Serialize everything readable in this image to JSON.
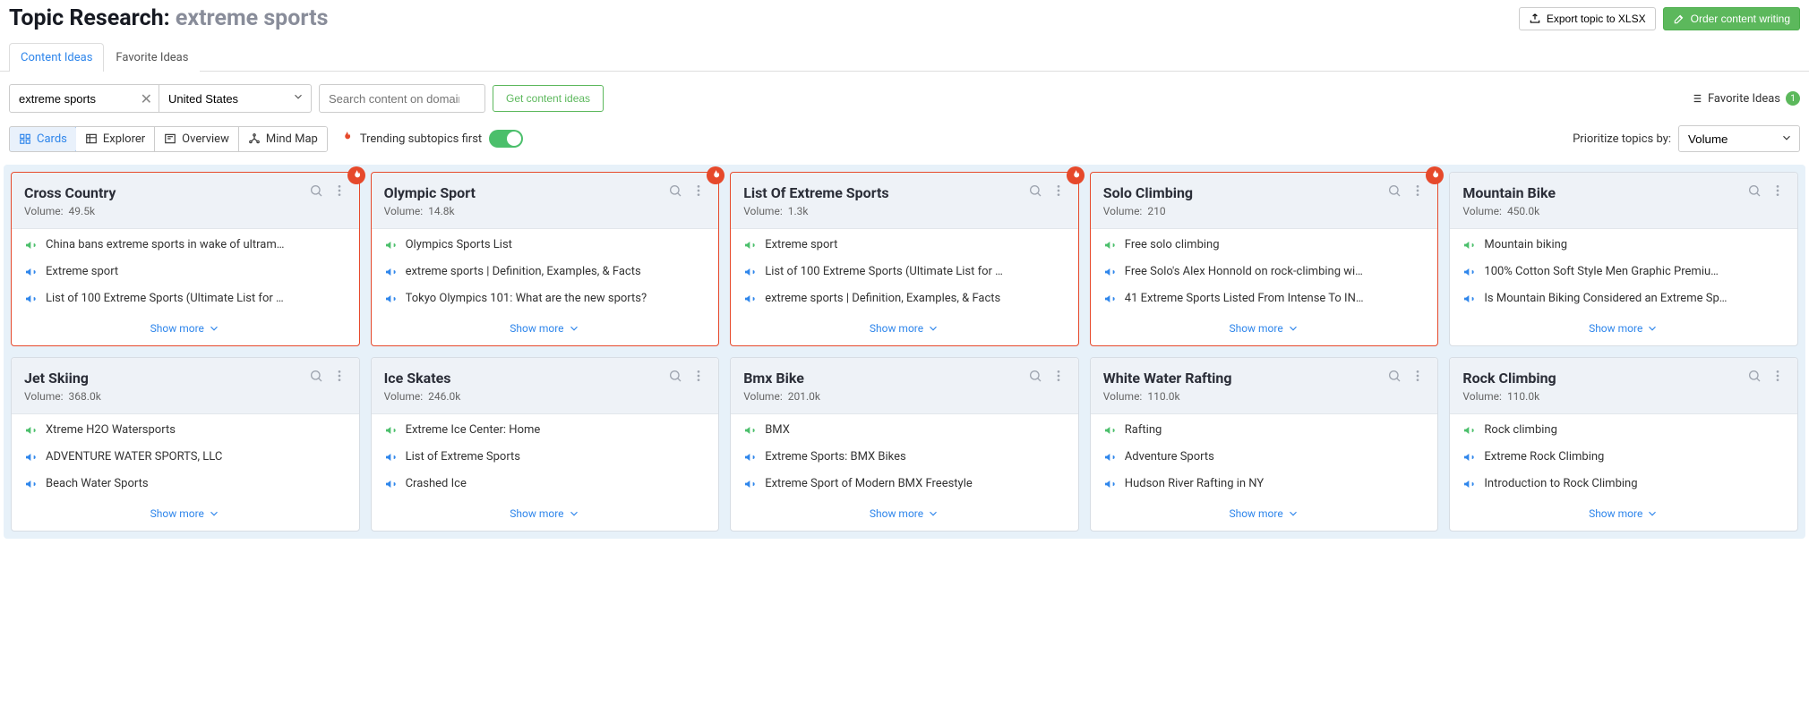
{
  "header": {
    "title_prefix": "Topic Research:",
    "title_topic": "extreme sports",
    "export_label": "Export topic to XLSX",
    "order_label": "Order content writing"
  },
  "tabs": {
    "content": "Content Ideas",
    "favorite": "Favorite Ideas"
  },
  "search": {
    "keyword": "extreme sports",
    "country": "United States",
    "domain_placeholder": "Search content on domain",
    "get_ideas": "Get content ideas",
    "favorite_label": "Favorite Ideas",
    "favorite_count": "1"
  },
  "views": {
    "cards": "Cards",
    "explorer": "Explorer",
    "overview": "Overview",
    "mindmap": "Mind Map",
    "trending_label": "Trending subtopics first",
    "prioritize_label": "Prioritize topics by:",
    "prioritize_value": "Volume"
  },
  "volume_label": "Volume:",
  "show_more": "Show more",
  "cards": [
    {
      "title": "Cross Country",
      "volume": "49.5k",
      "hot": true,
      "items": [
        {
          "type": "mega",
          "text": "China bans extreme sports in wake of ultram…"
        },
        {
          "type": "link",
          "text": "Extreme sport"
        },
        {
          "type": "link",
          "text": "List of 100 Extreme Sports (Ultimate List for …"
        }
      ]
    },
    {
      "title": "Olympic Sport",
      "volume": "14.8k",
      "hot": true,
      "items": [
        {
          "type": "mega",
          "text": "Olympics Sports List"
        },
        {
          "type": "link",
          "text": "extreme sports | Definition, Examples, & Facts"
        },
        {
          "type": "link",
          "text": "Tokyo Olympics 101: What are the new sports?"
        }
      ]
    },
    {
      "title": "List Of Extreme Sports",
      "volume": "1.3k",
      "hot": true,
      "items": [
        {
          "type": "mega",
          "text": "Extreme sport"
        },
        {
          "type": "link",
          "text": "List of 100 Extreme Sports (Ultimate List for …"
        },
        {
          "type": "link",
          "text": "extreme sports | Definition, Examples, & Facts"
        }
      ]
    },
    {
      "title": "Solo Climbing",
      "volume": "210",
      "hot": true,
      "items": [
        {
          "type": "mega",
          "text": "Free solo climbing"
        },
        {
          "type": "link",
          "text": "Free Solo's Alex Honnold on rock-climbing wi…"
        },
        {
          "type": "link",
          "text": "41 Extreme Sports Listed From Intense To IN…"
        }
      ]
    },
    {
      "title": "Mountain Bike",
      "volume": "450.0k",
      "hot": false,
      "items": [
        {
          "type": "mega",
          "text": "Mountain biking"
        },
        {
          "type": "link",
          "text": "100% Cotton Soft Style Men Graphic Premiu…"
        },
        {
          "type": "link",
          "text": "Is Mountain Biking Considered an Extreme Sp…"
        }
      ]
    },
    {
      "title": "Jet Skiing",
      "volume": "368.0k",
      "hot": false,
      "items": [
        {
          "type": "mega",
          "text": "Xtreme H2O Watersports"
        },
        {
          "type": "link",
          "text": "ADVENTURE WATER SPORTS, LLC"
        },
        {
          "type": "link",
          "text": "Beach Water Sports"
        }
      ]
    },
    {
      "title": "Ice Skates",
      "volume": "246.0k",
      "hot": false,
      "items": [
        {
          "type": "mega",
          "text": "Extreme Ice Center: Home"
        },
        {
          "type": "link",
          "text": "List of Extreme Sports"
        },
        {
          "type": "link",
          "text": "Crashed Ice"
        }
      ]
    },
    {
      "title": "Bmx Bike",
      "volume": "201.0k",
      "hot": false,
      "items": [
        {
          "type": "mega",
          "text": "BMX"
        },
        {
          "type": "link",
          "text": "Extreme Sports: BMX Bikes"
        },
        {
          "type": "link",
          "text": "Extreme Sport of Modern BMX Freestyle"
        }
      ]
    },
    {
      "title": "White Water Rafting",
      "volume": "110.0k",
      "hot": false,
      "items": [
        {
          "type": "mega",
          "text": "Rafting"
        },
        {
          "type": "link",
          "text": "Adventure Sports"
        },
        {
          "type": "link",
          "text": "Hudson River Rafting in NY"
        }
      ]
    },
    {
      "title": "Rock Climbing",
      "volume": "110.0k",
      "hot": false,
      "items": [
        {
          "type": "mega",
          "text": "Rock climbing"
        },
        {
          "type": "link",
          "text": "Extreme Rock Climbing"
        },
        {
          "type": "link",
          "text": "Introduction to Rock Climbing"
        }
      ]
    }
  ]
}
